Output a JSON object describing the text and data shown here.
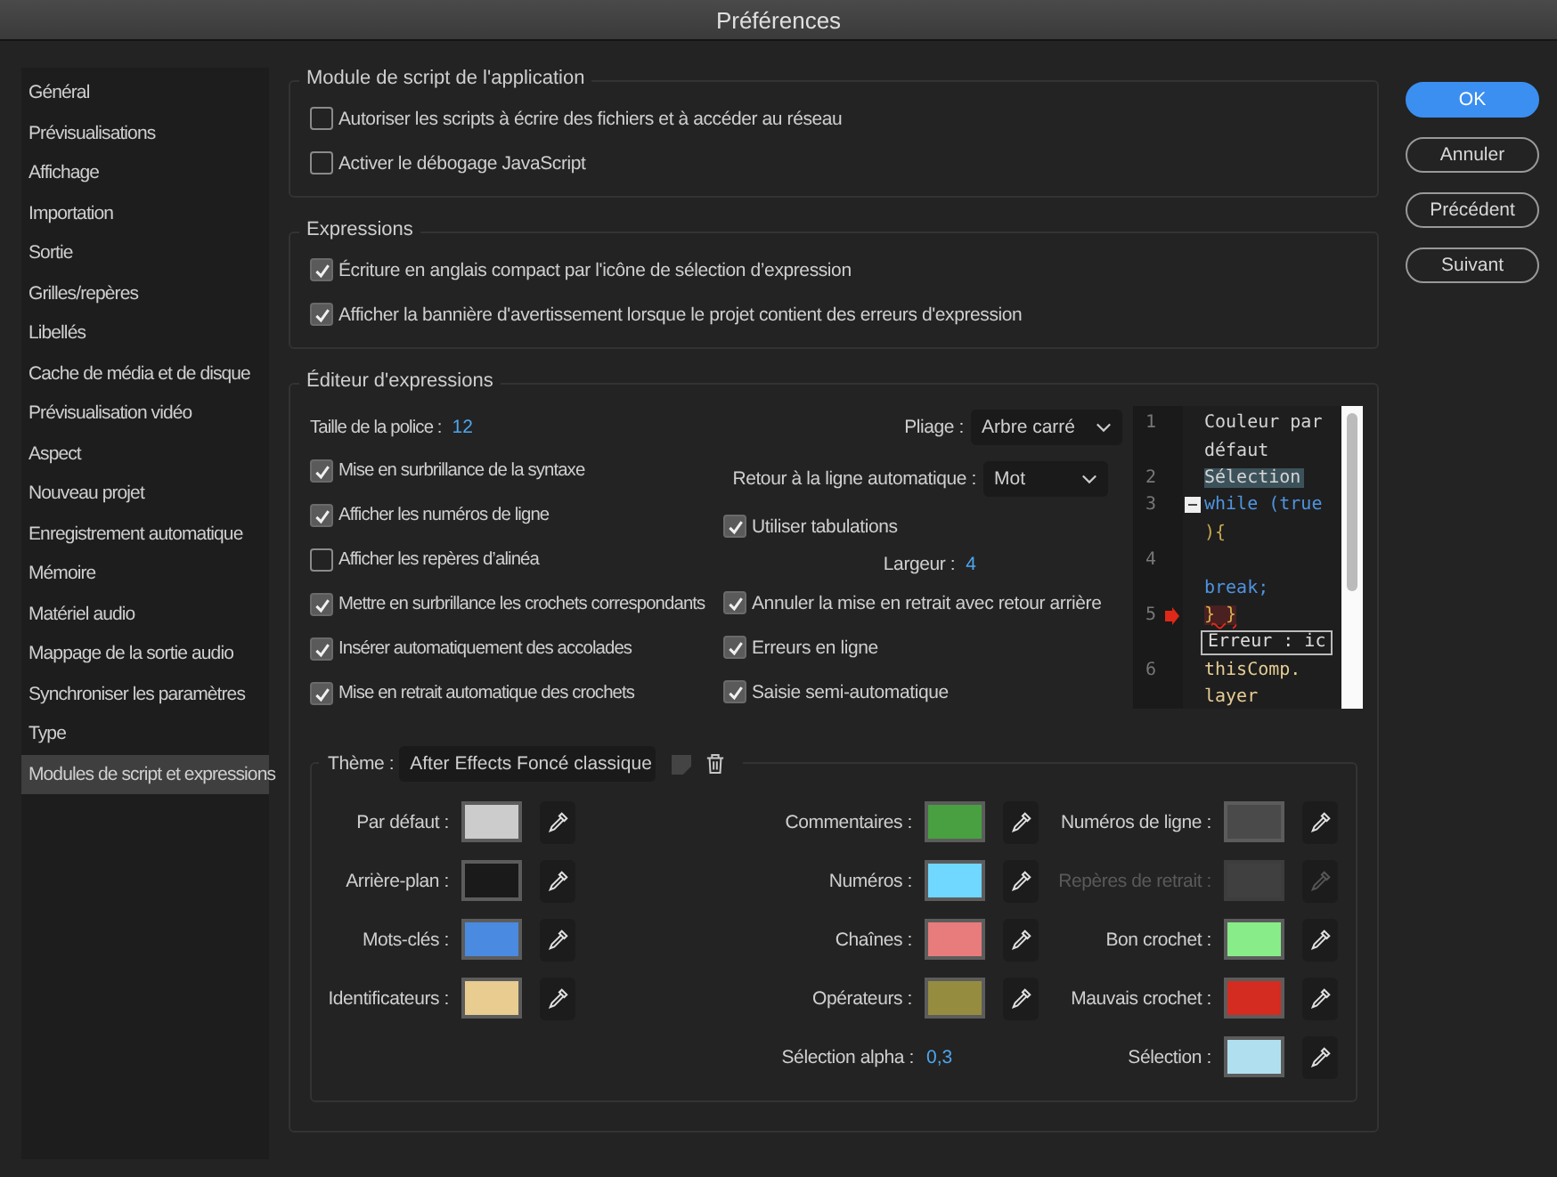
{
  "window": {
    "title": "Préférences"
  },
  "sidebar": {
    "items": [
      {
        "label": "Général",
        "selected": false
      },
      {
        "label": "Prévisualisations",
        "selected": false
      },
      {
        "label": "Affichage",
        "selected": false
      },
      {
        "label": "Importation",
        "selected": false
      },
      {
        "label": "Sortie",
        "selected": false
      },
      {
        "label": "Grilles/repères",
        "selected": false
      },
      {
        "label": "Libellés",
        "selected": false
      },
      {
        "label": "Cache de média et de disque",
        "selected": false
      },
      {
        "label": "Prévisualisation vidéo",
        "selected": false
      },
      {
        "label": "Aspect",
        "selected": false
      },
      {
        "label": "Nouveau projet",
        "selected": false
      },
      {
        "label": "Enregistrement automatique",
        "selected": false
      },
      {
        "label": "Mémoire",
        "selected": false
      },
      {
        "label": "Matériel audio",
        "selected": false
      },
      {
        "label": "Mappage de la sortie audio",
        "selected": false
      },
      {
        "label": "Synchroniser les paramètres",
        "selected": false
      },
      {
        "label": "Type",
        "selected": false
      },
      {
        "label": "Modules de script et expressions",
        "selected": true
      }
    ]
  },
  "sections": [
    {
      "title": "Module de script de l'application",
      "options": [
        {
          "label": "Autoriser les scripts à écrire des fichiers et à accéder au réseau",
          "checked": false
        },
        {
          "label": "Activer le débogage JavaScript",
          "checked": false
        }
      ]
    },
    {
      "title": "Expressions",
      "options": [
        {
          "label": "Écriture en anglais compact par l'icône de sélection d’expression",
          "checked": true
        },
        {
          "label": "Afficher la bannière d'avertissement lorsque le projet contient des erreurs d'expression",
          "checked": true
        }
      ]
    }
  ],
  "editor": {
    "title": "Éditeur d'expressions",
    "left": [
      {
        "kind": "value",
        "label": "Taille de la police :",
        "value": "12"
      },
      {
        "kind": "checkbox",
        "label": "Mise en surbrillance de la syntaxe",
        "checked": true
      },
      {
        "kind": "checkbox",
        "label": "Afficher les numéros de ligne",
        "checked": true
      },
      {
        "kind": "checkbox",
        "label": "Afficher les repères d’alinéa",
        "checked": false
      },
      {
        "kind": "checkbox",
        "label": "Mettre en surbrillance les crochets correspondants",
        "checked": true
      },
      {
        "kind": "checkbox",
        "label": "Insérer automatiquement des accolades",
        "checked": true
      },
      {
        "kind": "checkbox",
        "label": "Mise en retrait automatique des crochets",
        "checked": true
      }
    ],
    "right": [
      {
        "kind": "dropdown",
        "label": "Pliage :",
        "value": "Arbre carré"
      },
      {
        "kind": "dropdown",
        "label": "Retour à la ligne automatique :",
        "value": "Mot"
      },
      {
        "kind": "checkbox",
        "label": "Utiliser tabulations",
        "checked": true
      },
      {
        "kind": "value",
        "label": "Largeur :",
        "value": "4"
      },
      {
        "kind": "checkbox",
        "label": "Annuler la mise en retrait avec retour arrière",
        "checked": true
      },
      {
        "kind": "checkbox",
        "label": "Erreurs en ligne",
        "checked": true
      },
      {
        "kind": "checkbox",
        "label": "Saisie semi-automatique",
        "checked": true
      }
    ],
    "preview": {
      "rows": [
        {
          "number": "1",
          "tokens": [
            {
              "text": "Couleur par",
              "kind": "default"
            }
          ]
        },
        {
          "tokens": [
            {
              "text": " défaut",
              "kind": "default"
            }
          ]
        },
        {
          "number": "2",
          "tokens": [
            {
              "text": "Sélection",
              "kind": "selection"
            }
          ]
        },
        {
          "number": "3",
          "fold": true,
          "tokens": [
            {
              "text": "while (true",
              "kind": "keyword"
            }
          ]
        },
        {
          "tokens": [
            {
              "text": "){",
              "kind": "operator"
            }
          ]
        },
        {
          "number": "4",
          "tokens": []
        },
        {
          "tokens": [
            {
              "text": "break;",
              "kind": "keyword"
            }
          ]
        },
        {
          "number": "5",
          "error": true,
          "tokens": [
            {
              "text": "} }",
              "kind": "bad_bracket"
            }
          ]
        },
        {
          "tooltip": "Erreur : ic"
        },
        {
          "number": "6",
          "tokens": [
            {
              "text": "thisComp.",
              "kind": "identifier"
            }
          ]
        },
        {
          "tokens": [
            {
              "text": "layer",
              "kind": "identifier"
            }
          ]
        }
      ]
    },
    "theme": {
      "label": "Thème :",
      "value": "After Effects Foncé classique",
      "columns": [
        [
          {
            "kind": "swatch",
            "label": "Par défaut :",
            "color": "#cccccc",
            "disabled": false
          },
          {
            "kind": "swatch",
            "label": "Arrière-plan :",
            "color": "#1a1a1a",
            "disabled": false
          },
          {
            "kind": "swatch",
            "label": "Mots-clés :",
            "color": "#4a8ae0",
            "disabled": false
          },
          {
            "kind": "swatch",
            "label": "Identificateurs :",
            "color": "#e8cc90",
            "disabled": false
          }
        ],
        [
          {
            "kind": "swatch",
            "label": "Commentaires :",
            "color": "#48a040",
            "disabled": false
          },
          {
            "kind": "swatch",
            "label": "Numéros :",
            "color": "#70d8ff",
            "disabled": false
          },
          {
            "kind": "swatch",
            "label": "Chaînes :",
            "color": "#e87c7c",
            "disabled": false
          },
          {
            "kind": "swatch",
            "label": "Opérateurs :",
            "color": "#968c40",
            "disabled": false
          },
          {
            "kind": "value",
            "label": "Sélection alpha :",
            "value": "0,3"
          }
        ],
        [
          {
            "kind": "swatch",
            "label": "Numéros de ligne :",
            "color": "#4a4a4a",
            "disabled": false
          },
          {
            "kind": "swatch",
            "label": "Repères de retrait :",
            "color": "#484848",
            "disabled": true
          },
          {
            "kind": "swatch",
            "label": "Bon crochet :",
            "color": "#88ec88",
            "disabled": false
          },
          {
            "kind": "swatch",
            "label": "Mauvais crochet :",
            "color": "#d42c20",
            "disabled": false
          },
          {
            "kind": "swatch",
            "label": "Sélection :",
            "color": "#b0e0f0",
            "disabled": false
          }
        ]
      ]
    }
  },
  "buttons": [
    {
      "label": "OK",
      "primary": true
    },
    {
      "label": "Annuler",
      "primary": false
    },
    {
      "label": "Précédent",
      "primary": false
    },
    {
      "label": "Suivant",
      "primary": false
    }
  ]
}
